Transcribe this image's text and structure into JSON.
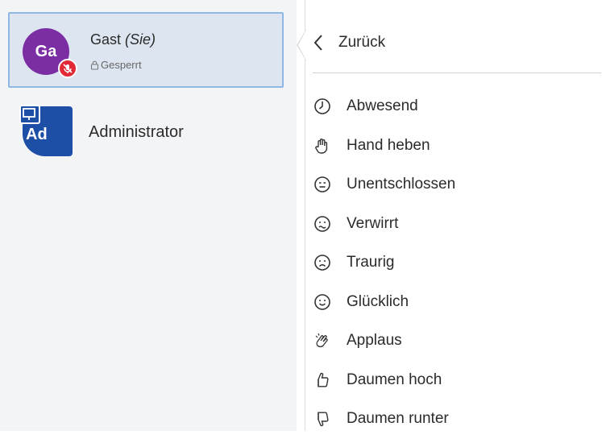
{
  "users": {
    "current": {
      "initials": "Ga",
      "name": "Gast",
      "you_suffix": "(Sie)",
      "status": "Gesperrt",
      "avatar_color": "#7b2da3",
      "badge_color": "#e12a35"
    },
    "admin": {
      "initials": "Ad",
      "name": "Administrator",
      "avatar_color": "#1c4fa5"
    }
  },
  "menu": {
    "back_label": "Zurück",
    "items": [
      {
        "icon": "clock-icon",
        "label": "Abwesend"
      },
      {
        "icon": "hand-icon",
        "label": "Hand heben"
      },
      {
        "icon": "neutral-face-icon",
        "label": "Unentschlossen"
      },
      {
        "icon": "confused-face-icon",
        "label": "Verwirrt"
      },
      {
        "icon": "sad-face-icon",
        "label": "Traurig"
      },
      {
        "icon": "happy-face-icon",
        "label": "Glücklich"
      },
      {
        "icon": "applause-icon",
        "label": "Applaus"
      },
      {
        "icon": "thumbs-up-icon",
        "label": "Daumen hoch"
      },
      {
        "icon": "thumbs-down-icon",
        "label": "Daumen runter"
      }
    ]
  }
}
